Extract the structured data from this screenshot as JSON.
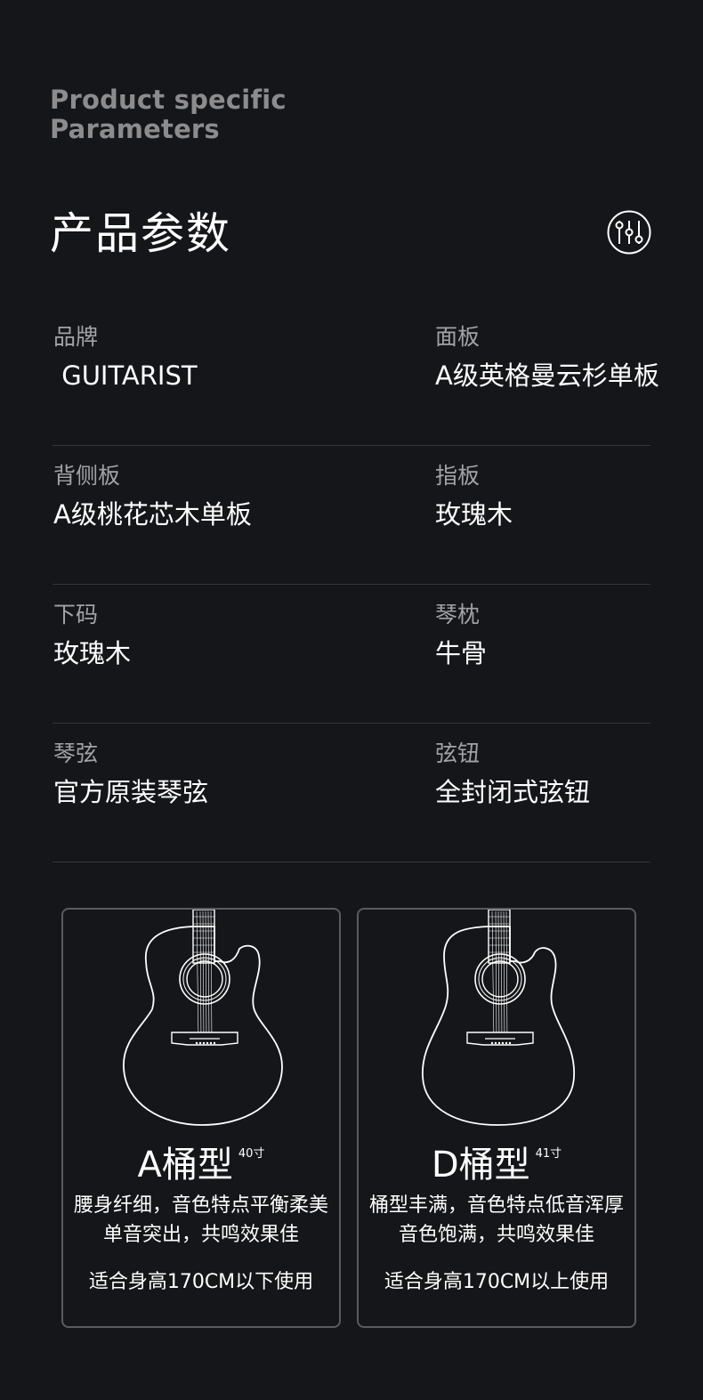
{
  "header": {
    "eyebrow_line1": "Product specific",
    "eyebrow_line2": "Parameters",
    "title": "产品参数",
    "icon": "sliders-icon"
  },
  "params": [
    {
      "left": {
        "label": "品牌",
        "value": " GUITARIST"
      },
      "right": {
        "label": "面板",
        "value": "A级英格曼云杉单板"
      }
    },
    {
      "left": {
        "label": "背侧板",
        "value": "A级桃花芯木单板"
      },
      "right": {
        "label": "指板",
        "value": "玫瑰木"
      }
    },
    {
      "left": {
        "label": "下码",
        "value": "玫瑰木"
      },
      "right": {
        "label": "琴枕",
        "value": "牛骨"
      }
    },
    {
      "left": {
        "label": "琴弦",
        "value": "官方原装琴弦"
      },
      "right": {
        "label": "弦钮",
        "value": "全封闭式弦钮"
      }
    }
  ],
  "body_types": [
    {
      "name": "A桶型",
      "size": "40寸",
      "desc_line1": "腰身纤细，音色特点平衡柔美",
      "desc_line2": "单音突出，共鸣效果佳",
      "fit": "适合身高170CM以下使用",
      "icon": "guitar-a-body-icon"
    },
    {
      "name": "D桶型",
      "size": "41寸",
      "desc_line1": "桶型丰满，音色特点低音浑厚",
      "desc_line2": "音色饱满，共鸣效果佳",
      "fit": "适合身高170CM以上使用",
      "icon": "guitar-d-body-icon"
    }
  ],
  "colors": {
    "background": "#15161a",
    "text": "#ffffff",
    "label": "#a2a3a6",
    "eyebrow": "#8c8c8e",
    "divider": "#35363a",
    "card_border": "#5a5b60"
  }
}
